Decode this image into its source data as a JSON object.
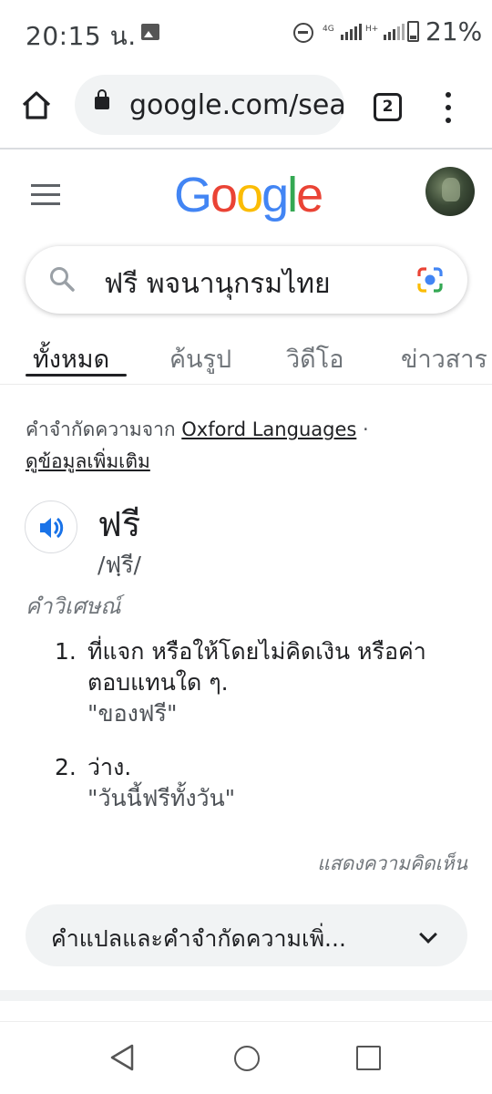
{
  "status_bar": {
    "time": "20:15 น.",
    "network_1": "4G",
    "network_2": "H+",
    "battery": "21%"
  },
  "browser": {
    "url": "google.com/search",
    "tab_count": "2"
  },
  "google": {
    "logo": [
      "G",
      "o",
      "o",
      "g",
      "l",
      "e"
    ],
    "logo_colors": [
      "#4285F4",
      "#EA4335",
      "#FBBC05",
      "#4285F4",
      "#34A853",
      "#EA4335"
    ]
  },
  "search": {
    "query": "ฟรี พจนานุกรมไทย"
  },
  "tabs": [
    {
      "label": "ทั้งหมด",
      "active": true
    },
    {
      "label": "ค้นรูป",
      "active": false
    },
    {
      "label": "วิดีโอ",
      "active": false
    },
    {
      "label": "ข่าวสาร",
      "active": false
    }
  ],
  "dictionary": {
    "source_prefix": "คำจำกัดความจาก",
    "source_name": "Oxford Languages",
    "source_suffix": "·",
    "more_info": "ดูข้อมูลเพิ่มเติม",
    "word": "ฟรี",
    "phonetic": "/ฟฺรี/",
    "part_of_speech": "คำวิเศษณ์",
    "definitions": [
      {
        "num": "1.",
        "text": "ที่แจก หรือให้โดยไม่คิดเงิน หรือค่าตอบแทนใด ๆ.",
        "example": "\"ของฟรี\""
      },
      {
        "num": "2.",
        "text": "ว่าง.",
        "example": "\"วันนี้ฟรีทั้งวัน\""
      }
    ],
    "feedback": "แสดงความคิดเห็น",
    "expand_label": "คำแปลและคำจำกัดความเพิ่..."
  },
  "icons": {
    "home": "home-icon",
    "lock": "lock-icon",
    "menu": "more-vert-icon",
    "search": "search-icon",
    "lens": "google-lens-icon",
    "speaker": "speaker-icon",
    "chevron": "chevron-down-icon"
  },
  "colors": {
    "link": "#202124",
    "muted": "#70757a",
    "pill_bg": "#f1f3f4",
    "speaker_blue": "#1a73e8"
  }
}
